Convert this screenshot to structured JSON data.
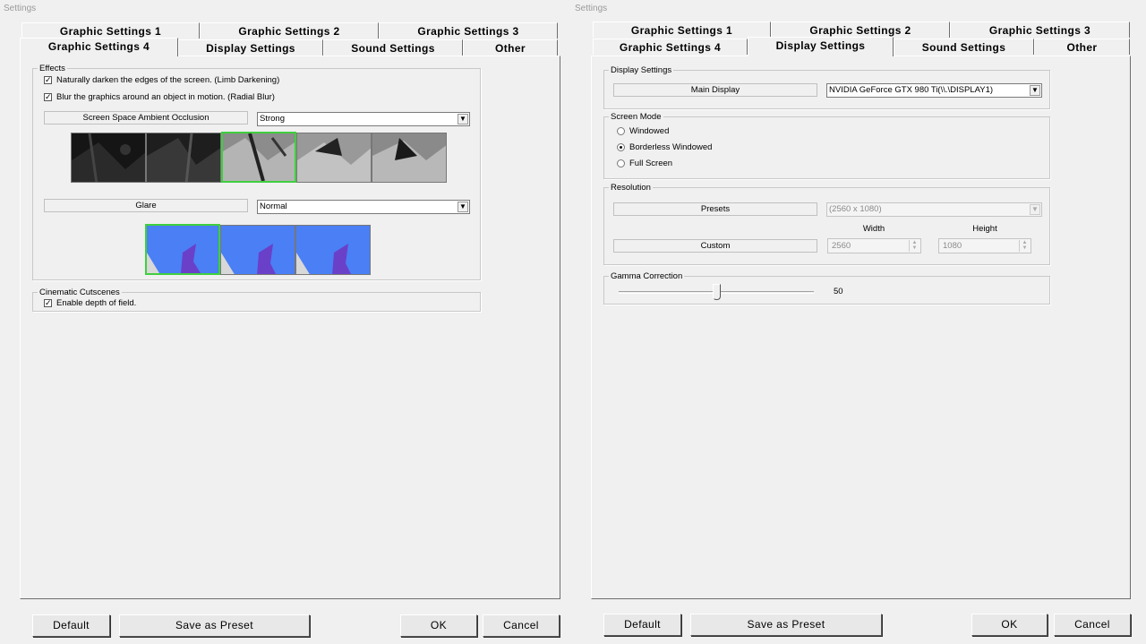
{
  "left": {
    "window_title": "Settings",
    "tabs_row1": [
      "Graphic Settings 1",
      "Graphic Settings 2",
      "Graphic Settings 3"
    ],
    "tabs_row2": [
      "Graphic Settings 4",
      "Display Settings",
      "Sound Settings",
      "Other"
    ],
    "active_tab": "Graphic Settings 4",
    "effects": {
      "title": "Effects",
      "limb_darkening": {
        "label": "Naturally darken the edges of the screen. (Limb Darkening)",
        "checked": true
      },
      "radial_blur": {
        "label": "Blur the graphics around an object in motion. (Radial Blur)",
        "checked": true
      },
      "ssao": {
        "label": "Screen Space Ambient Occlusion",
        "value": "Strong",
        "selected_preview_index": 2
      },
      "glare": {
        "label": "Glare",
        "value": "Normal",
        "selected_preview_index": 0
      }
    },
    "cinematic": {
      "title": "Cinematic Cutscenes",
      "depth_of_field": {
        "label": "Enable depth of field.",
        "checked": true
      }
    },
    "buttons": {
      "default": "Default",
      "save_preset": "Save as Preset",
      "ok": "OK",
      "cancel": "Cancel"
    }
  },
  "right": {
    "window_title": "Settings",
    "tabs_row1": [
      "Graphic Settings 1",
      "Graphic Settings 2",
      "Graphic Settings 3"
    ],
    "tabs_row2": [
      "Graphic Settings 4",
      "Display Settings",
      "Sound Settings",
      "Other"
    ],
    "active_tab": "Display Settings",
    "display_settings": {
      "title": "Display Settings",
      "main_display_label": "Main Display",
      "main_display_value": "NVIDIA GeForce GTX 980 Ti(\\\\.\\DISPLAY1)"
    },
    "screen_mode": {
      "title": "Screen Mode",
      "options": [
        "Windowed",
        "Borderless Windowed",
        "Full Screen"
      ],
      "selected": "Borderless Windowed"
    },
    "resolution": {
      "title": "Resolution",
      "presets_label": "Presets",
      "presets_value": "(2560 x 1080)",
      "custom_label": "Custom",
      "width_label": "Width",
      "height_label": "Height",
      "width_value": "2560",
      "height_value": "1080"
    },
    "gamma": {
      "title": "Gamma Correction",
      "value": "50",
      "level_fraction": 0.5
    },
    "buttons": {
      "default": "Default",
      "save_preset": "Save as Preset",
      "ok": "OK",
      "cancel": "Cancel"
    }
  },
  "icons": {
    "check": "check-icon",
    "dropdown": "dropdown-arrow-icon",
    "spin": "spin-arrows-icon"
  },
  "colors": {
    "selection_border": "#3fcf3f",
    "sky_blue": "#4a7ff5",
    "panel_bg": "#f0f0f0"
  }
}
